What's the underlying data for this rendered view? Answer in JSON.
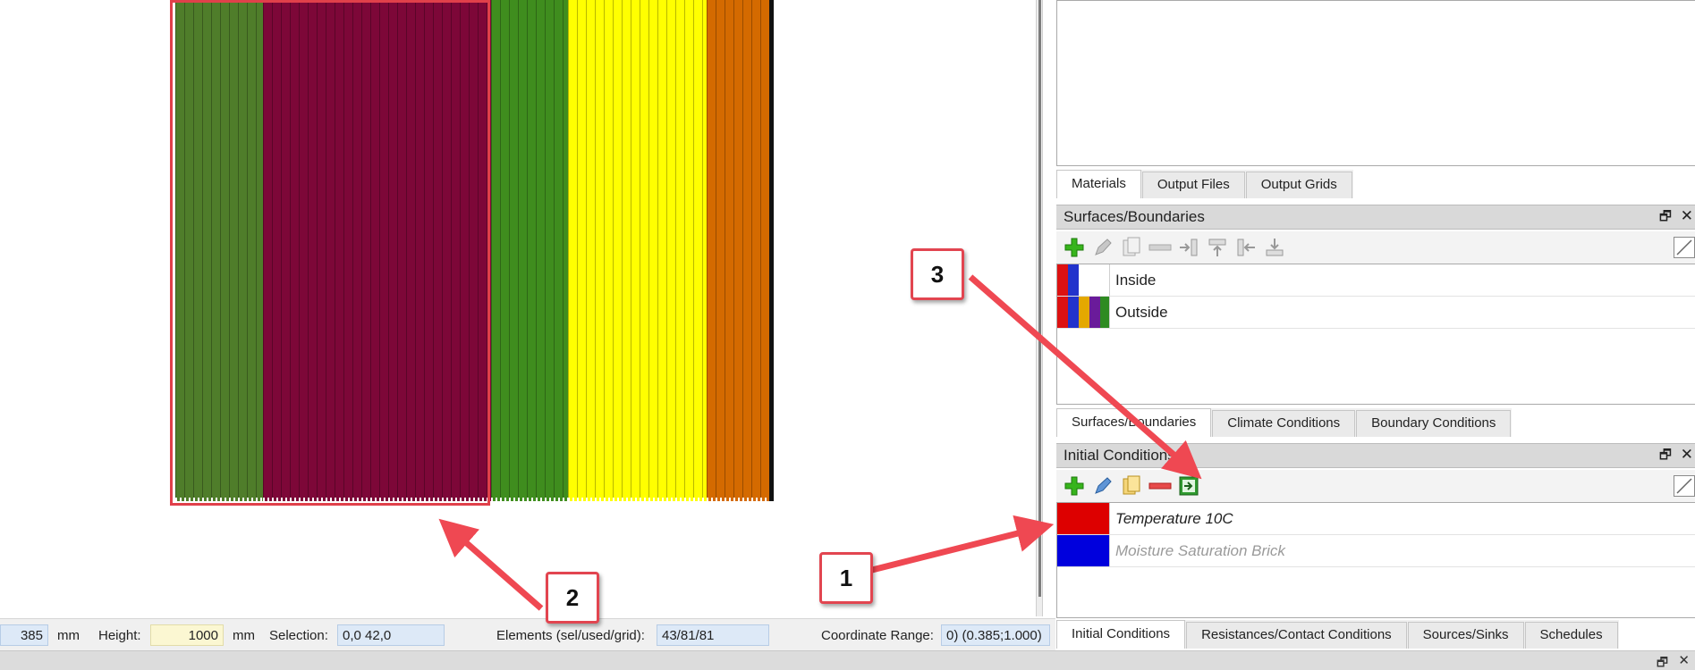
{
  "layers": [
    {
      "color": "#4f7d2a",
      "width": 98
    },
    {
      "color": "#7d0738",
      "width": 255
    },
    {
      "color": "#3f8d1e",
      "width": 86
    },
    {
      "color": "#ffff00",
      "width": 155
    },
    {
      "color": "#d46a00",
      "width": 74
    }
  ],
  "status": {
    "width_value": "385",
    "unit1": "mm",
    "height_label": "Height:",
    "height_value": "1000",
    "unit2": "mm",
    "selection_label": "Selection:",
    "selection_value": "0,0  42,0",
    "elements_label": "Elements (sel/used/grid):",
    "elements_value": "43/81/81",
    "coord_label": "Coordinate Range:",
    "coord_value": "0)  (0.385;1.000)"
  },
  "materials_tabs": {
    "tab1": "Materials",
    "tab2": "Output Files",
    "tab3": "Output Grids"
  },
  "surfaces_panel": {
    "title": "Surfaces/Boundaries",
    "restore": "🗗",
    "close": "✕",
    "rows": [
      {
        "label": "Inside",
        "colors": [
          "#dd1111",
          "#2233cc",
          "#ffffff",
          "#ffffff"
        ]
      },
      {
        "label": "Outside",
        "colors": [
          "#dd1111",
          "#2233cc",
          "#e4a800",
          "#6a1b9a",
          "#2e8b22"
        ]
      }
    ]
  },
  "surfaces_tabs": {
    "tab1": "Surfaces/Boundaries",
    "tab2": "Climate Conditions",
    "tab3": "Boundary Conditions"
  },
  "initial_panel": {
    "title": "Initial Conditions",
    "restore": "🗗",
    "close": "✕",
    "rows": [
      {
        "label": "Temperature 10C",
        "color": "#dd0000"
      },
      {
        "label": "Moisture Saturation Brick",
        "color": "#0000dd"
      }
    ]
  },
  "bottom_tabs": {
    "tab1": "Initial Conditions",
    "tab2": "Resistances/Contact Conditions",
    "tab3": "Sources/Sinks",
    "tab4": "Schedules"
  },
  "bottom_strip": {
    "restore": "🗗",
    "close": "✕"
  },
  "callouts": {
    "c1": "1",
    "c2": "2",
    "c3": "3"
  },
  "colors": {
    "accent_red": "#e24550",
    "panel_header": "#d9d9d9",
    "field_blue": "#dde9f7",
    "field_yellow": "#fbf7d2"
  }
}
